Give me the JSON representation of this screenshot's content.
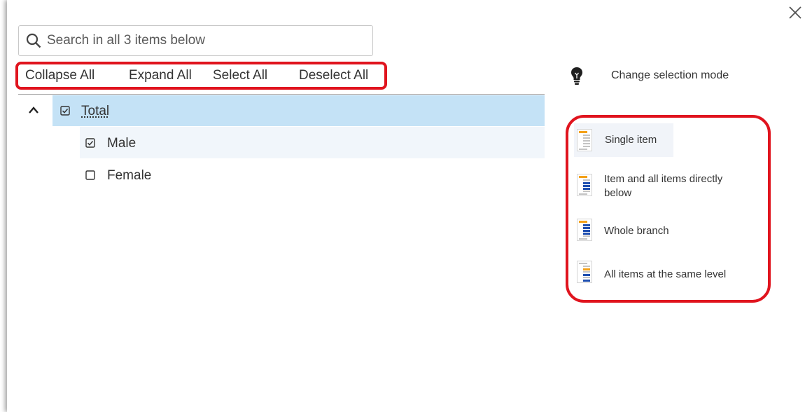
{
  "search": {
    "placeholder": "Search in all 3 items below"
  },
  "toolbar": {
    "collapse_all": "Collapse All",
    "expand_all": "Expand All",
    "select_all": "Select All",
    "deselect_all": "Deselect All"
  },
  "tree": {
    "items": [
      {
        "label": "Total",
        "checked": true,
        "expanded": true
      },
      {
        "label": "Male",
        "checked": true
      },
      {
        "label": "Female",
        "checked": false
      }
    ]
  },
  "selection_mode": {
    "title": "Change selection mode",
    "options": [
      {
        "label": "Single item",
        "selected": true
      },
      {
        "label": "Item and all items directly below",
        "selected": false
      },
      {
        "label": "Whole branch",
        "selected": false
      },
      {
        "label": "All items at the same level",
        "selected": false
      }
    ]
  },
  "colors": {
    "highlight_red": "#e0141e",
    "selected_row": "#c4e2f6",
    "icon_orange": "#f4a21a",
    "icon_blue": "#1f4fb0"
  }
}
